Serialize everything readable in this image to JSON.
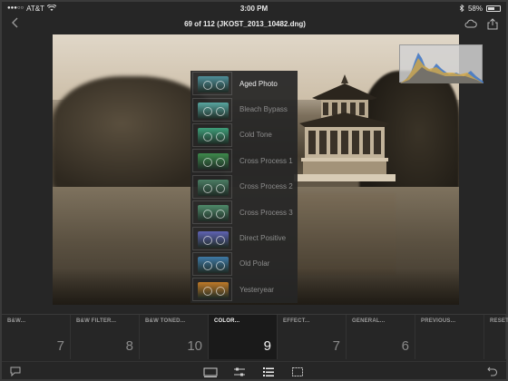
{
  "status": {
    "carrier": "AT&T",
    "time": "3:00 PM",
    "battery": "58%",
    "battery_level": 0.58
  },
  "header": {
    "title": "69 of 112 (JKOST_2013_10482.dng)"
  },
  "preset_menu": {
    "items": [
      {
        "label": "Aged Photo",
        "active": true,
        "color": "#4f8f99"
      },
      {
        "label": "Bleach Bypass",
        "active": false,
        "color": "#58a6a0"
      },
      {
        "label": "Cold Tone",
        "active": false,
        "color": "#3f9f7a"
      },
      {
        "label": "Cross Process 1",
        "active": false,
        "color": "#3e8a4c"
      },
      {
        "label": "Cross Process 2",
        "active": false,
        "color": "#4a7d63"
      },
      {
        "label": "Cross Process 3",
        "active": false,
        "color": "#4f8a6a"
      },
      {
        "label": "Direct Positive",
        "active": false,
        "color": "#5f63b4"
      },
      {
        "label": "Old Polar",
        "active": false,
        "color": "#3f7aa6"
      },
      {
        "label": "Yesteryear",
        "active": false,
        "color": "#c07a28"
      }
    ]
  },
  "filters": {
    "tabs": [
      {
        "name": "B&W...",
        "count": "7",
        "active": false
      },
      {
        "name": "B&W FILTER...",
        "count": "8",
        "active": false
      },
      {
        "name": "B&W TONED...",
        "count": "10",
        "active": false
      },
      {
        "name": "COLOR...",
        "count": "9",
        "active": true
      },
      {
        "name": "EFFECT...",
        "count": "7",
        "active": false
      },
      {
        "name": "GENERAL...",
        "count": "6",
        "active": false
      },
      {
        "name": "PREVIOUS...",
        "count": "",
        "active": false
      },
      {
        "name": "RESET",
        "count": "",
        "active": false
      }
    ]
  },
  "colors": {
    "active_tab_bg": "#1a1a1a",
    "menu_bg": "#262626"
  },
  "icons": {
    "back": "chevron-left-icon",
    "cloud": "cloud-icon",
    "share": "share-icon",
    "comment": "comment-icon",
    "presets": "presets-icon",
    "adjust": "sliders-icon",
    "list": "list-icon",
    "crop": "crop-icon",
    "undo": "undo-icon"
  }
}
